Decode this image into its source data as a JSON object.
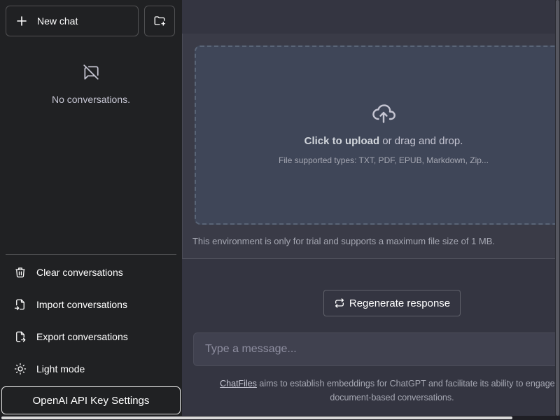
{
  "sidebar": {
    "new_chat_label": "New chat",
    "empty_text": "No conversations.",
    "items": [
      {
        "label": "Clear conversations",
        "icon": "trash-icon"
      },
      {
        "label": "Import conversations",
        "icon": "file-import-icon"
      },
      {
        "label": "Export conversations",
        "icon": "file-export-icon"
      },
      {
        "label": "Light mode",
        "icon": "sun-icon"
      }
    ],
    "api_key_label": "OpenAI API Key Settings"
  },
  "upload": {
    "click_label": "Click to upload",
    "drag_label": " or drag and drop.",
    "supported_types": "File supported types: TXT, PDF, EPUB, Markdown, Zip...",
    "trial_note": "This environment is only for trial and supports a maximum file size of 1 MB."
  },
  "chat": {
    "regenerate_label": "Regenerate response",
    "input_placeholder": "Type a message...",
    "footer_link": "ChatFiles",
    "footer_text": " aims to establish embeddings for ChatGPT and facilitate its ability to engage in document-based conversations."
  },
  "colors": {
    "background": "#343541",
    "sidebar": "#202123",
    "dropzone": "#3f4658"
  }
}
